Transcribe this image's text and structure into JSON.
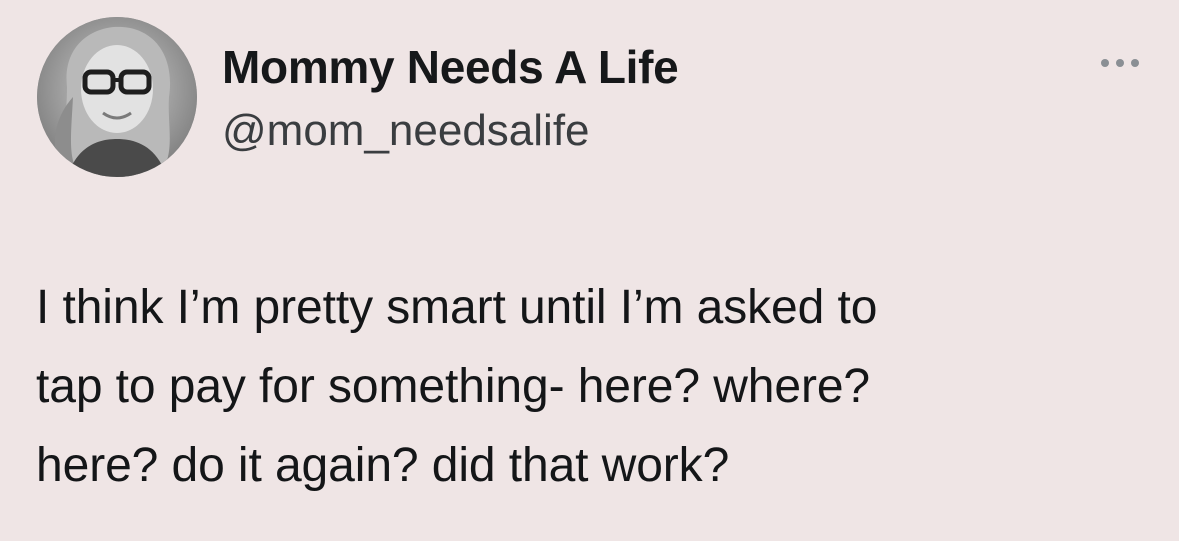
{
  "author": {
    "display_name": "Mommy Needs A Life",
    "handle": "@mom_needsalife",
    "avatar_icon": "profile-photo"
  },
  "more_icon": "more-horizontal-icon",
  "tweet": {
    "lines": [
      "I think I’m pretty smart until I’m asked to",
      "tap to pay for something- here? where?",
      "here? do it again? did that work?"
    ]
  },
  "colors": {
    "background": "#efe5e5",
    "text": "#16181a",
    "secondary_text": "#3a3d40"
  }
}
